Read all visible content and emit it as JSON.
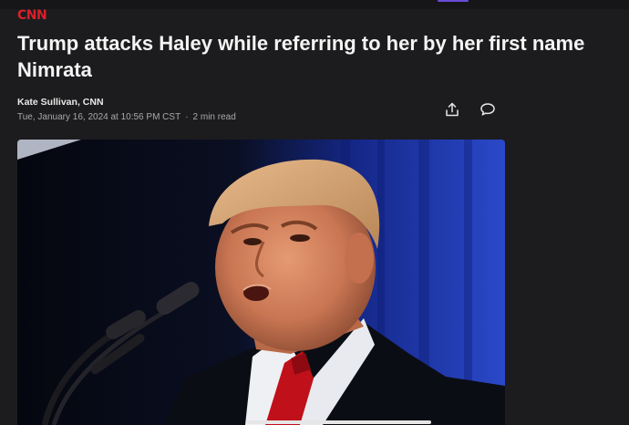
{
  "app": {
    "logo_text": "CNN",
    "accent_color": "#d9202b"
  },
  "article": {
    "headline": "Trump attacks Haley while referring to her by her first name Nimrata",
    "author": "Kate Sullivan, CNN",
    "timestamp": "Tue, January 16, 2024 at 10:56 PM CST",
    "read_time": "2 min read",
    "meta_separator": "·"
  },
  "actions": {
    "share_icon": "share-icon",
    "comment_icon": "comment-icon"
  },
  "hero_image": {
    "subject": "photo-speaker-at-microphone"
  }
}
